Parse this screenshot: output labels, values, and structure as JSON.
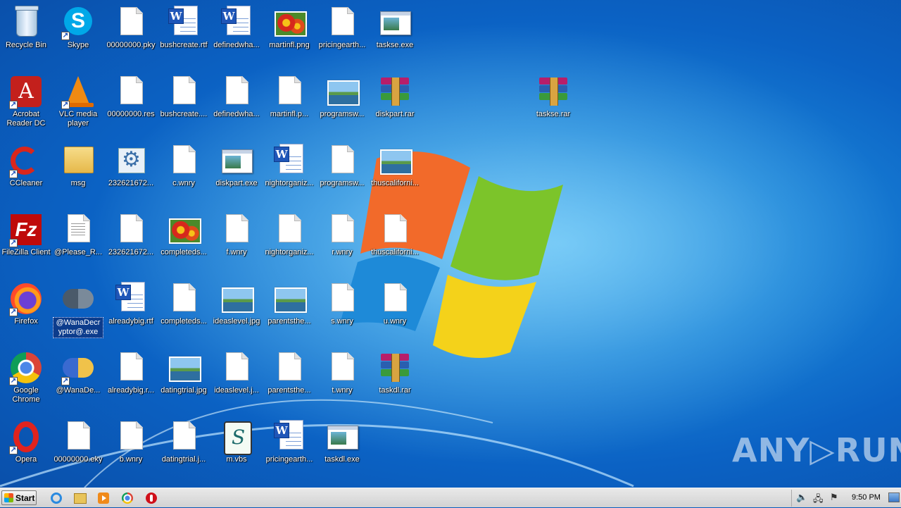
{
  "desktop": {
    "icons": {
      "recycle_bin": "Recycle Bin",
      "skype": "Skype",
      "pky": "00000000.pky",
      "bushcreate_rtf": "bushcreate.rtf",
      "definedwha_1": "definedwha...",
      "martinfl_png": "martinfl.png",
      "pricingearth_1": "pricingearth...",
      "taskse_exe": "taskse.exe",
      "acrobat": "Acrobat Reader DC",
      "vlc": "VLC media player",
      "res": "00000000.res",
      "bushcreate_2": "bushcreate....",
      "definedwha_2": "definedwha...",
      "martinfl_p": "martinfl.p...",
      "programsw_1": "programsw...",
      "diskpart_rar": "diskpart.rar",
      "taskse_rar": "taskse.rar",
      "ccleaner": "CCleaner",
      "msg": "msg",
      "num_1": "232621672...",
      "c_wnry": "c.wnry",
      "diskpart_exe": "diskpart.exe",
      "nightorganiz_1": "nightorganiz...",
      "programsw_2": "programsw...",
      "thuscaliforni_1": "thuscaliforni...",
      "filezilla": "FileZilla Client",
      "please_r": "@Please_R...",
      "num_2": "232621672...",
      "completeds_1": "completeds...",
      "f_wnry": "f.wnry",
      "nightorganiz_2": "nightorganiz...",
      "r_wnry": "r.wnry",
      "thuscaliforni_2": "thuscaliforni...",
      "firefox": "Firefox",
      "wanadecryptor_exe": "@WanaDecryptor@.exe",
      "alreadybig_rtf": "alreadybig.rtf",
      "completeds_2": "completeds...",
      "ideaslevel_jpg": "ideaslevel.jpg",
      "parentsthe_1": "parentsthe...",
      "s_wnry": "s.wnry",
      "u_wnry": "u.wnry",
      "chrome": "Google Chrome",
      "wanade": "@WanaDe...",
      "alreadybig_2": "alreadybig.r...",
      "datingtrial_jpg": "datingtrial.jpg",
      "ideaslevel_2": "ideaslevel.j...",
      "parentsthe_2": "parentsthe...",
      "t_wnry": "t.wnry",
      "taskdl_rar": "taskdl.rar",
      "opera": "Opera",
      "eky": "00000000.eky",
      "b_wnry": "b.wnry",
      "datingtrial_2": "datingtrial.j...",
      "m_vbs": "m.vbs",
      "pricingearth_2": "pricingearth...",
      "taskdl_exe": "taskdl.exe"
    }
  },
  "taskbar": {
    "start_label": "Start",
    "clock": "9:50 PM"
  },
  "watermark": "ANY▷RUN"
}
